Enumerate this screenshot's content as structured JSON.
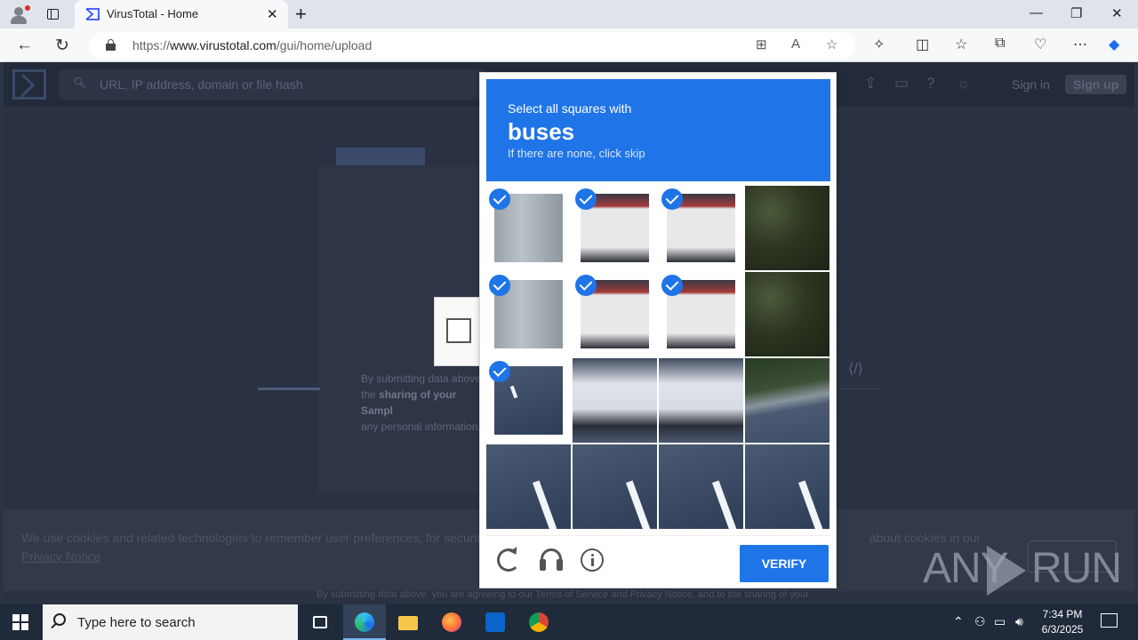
{
  "browser": {
    "tab_title": "VirusTotal - Home",
    "url_prefix": "https://",
    "url_domain": "www.virustotal.com",
    "url_path": "/gui/home/upload"
  },
  "vt": {
    "search_placeholder": "URL, IP address, domain or file hash",
    "sign_in": "Sign in",
    "sign_up": "Sign up",
    "submit_text_1": "By submitting data above,",
    "submit_text_2a": "the ",
    "submit_text_2b": "sharing of your Sampl",
    "submit_text_3": "any personal information,",
    "cookie_text": "We use cookies and related technologies to remember user preferences, for security, to",
    "cookie_text_end": "about cookies in our ",
    "cookie_link": "Privacy Notice",
    "bottom_text": "By submitting data above, you are agreeing to our Terms of Service and Privacy Notice, and to the sharing of your"
  },
  "captcha": {
    "prompt_line1": "Select all squares with",
    "prompt_target": "buses",
    "prompt_line3": "If there are none, click skip",
    "verify_label": "VERIFY",
    "tiles": [
      {
        "selected": true,
        "kind": "truckside"
      },
      {
        "selected": true,
        "kind": "truckback"
      },
      {
        "selected": true,
        "kind": "truckback"
      },
      {
        "selected": false,
        "kind": "trees"
      },
      {
        "selected": true,
        "kind": "truckside"
      },
      {
        "selected": true,
        "kind": "truckback"
      },
      {
        "selected": true,
        "kind": "truckback"
      },
      {
        "selected": false,
        "kind": "trees"
      },
      {
        "selected": true,
        "kind": "road"
      },
      {
        "selected": false,
        "kind": "busrear"
      },
      {
        "selected": false,
        "kind": "busrear"
      },
      {
        "selected": false,
        "kind": "rail"
      },
      {
        "selected": false,
        "kind": "road"
      },
      {
        "selected": false,
        "kind": "road"
      },
      {
        "selected": false,
        "kind": "road"
      },
      {
        "selected": false,
        "kind": "road"
      }
    ]
  },
  "watermark": {
    "left": "ANY",
    "right": "RUN"
  },
  "taskbar": {
    "search_placeholder": "Type here to search",
    "time": "7:34 PM",
    "date": "6/3/2025"
  }
}
